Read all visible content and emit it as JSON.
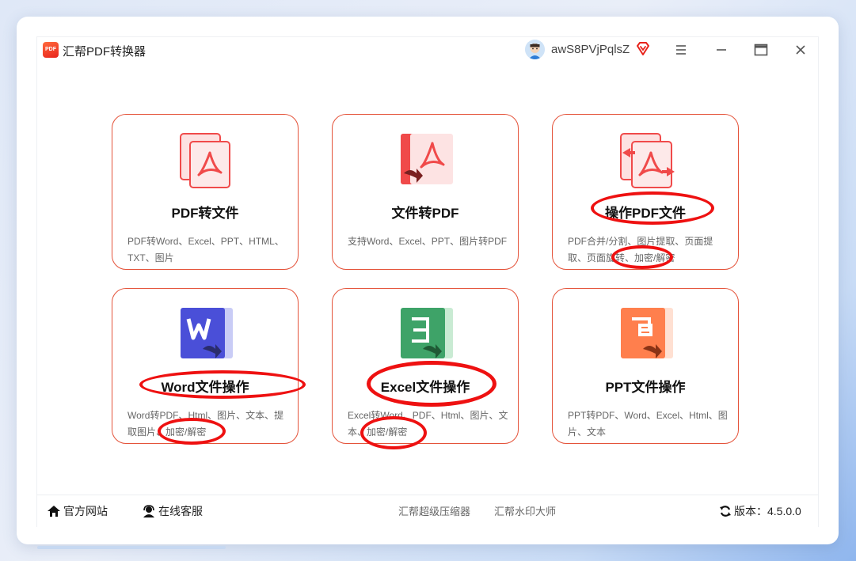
{
  "app": {
    "logo_text": "PDF",
    "title": "汇帮PDF转换器",
    "username": "awS8PVjPqlsZ"
  },
  "cards": [
    {
      "title": "PDF转文件",
      "desc": "PDF转Word、Excel、PPT、HTML、TXT、图片",
      "icon": "pdf-to-file-icon"
    },
    {
      "title": "文件转PDF",
      "desc": "支持Word、Excel、PPT、图片转PDF",
      "icon": "file-to-pdf-icon"
    },
    {
      "title": "操作PDF文件",
      "desc": "PDF合并/分割、图片提取、页面提取、页面旋转、加密/解密",
      "icon": "pdf-operate-icon"
    },
    {
      "title": "Word文件操作",
      "desc": "Word转PDF、Html、图片、文本、提取图片、加密/解密",
      "icon": "word-icon"
    },
    {
      "title": "Excel文件操作",
      "desc": "Excel转Word、PDF、Html、图片、文本、加密/解密",
      "icon": "excel-icon"
    },
    {
      "title": "PPT文件操作",
      "desc": "PPT转PDF、Word、Excel、Html、图片、文本",
      "icon": "ppt-icon"
    }
  ],
  "footer": {
    "website": "官方网站",
    "support": "在线客服",
    "link1": "汇帮超级压缩器",
    "link2": "汇帮水印大师",
    "version_label": "版本：4.5.0.0"
  },
  "colors": {
    "accent": "#e4533a",
    "pdf_red": "#f04a4a",
    "word_blue": "#4a4fd8",
    "excel_green": "#3ea368",
    "ppt_orange": "#ff7f4d",
    "annotation_red": "#ee1111"
  }
}
